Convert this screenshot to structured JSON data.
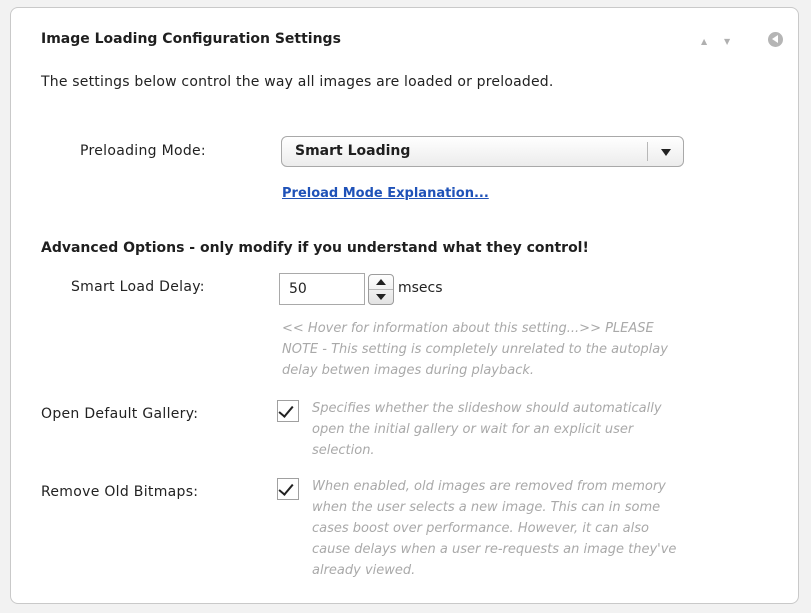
{
  "panel": {
    "title": "Image Loading Configuration Settings",
    "controls": {
      "move_up_icon": "triangle-up",
      "move_down_icon": "triangle-down",
      "collapse_icon": "circle-left-arrow"
    },
    "intro": "The settings below control the way all images are loaded or preloaded."
  },
  "preloading": {
    "label": "Preloading Mode:",
    "selected": "Smart Loading",
    "explanation_link": "Preload Mode Explanation..."
  },
  "advanced": {
    "heading": "Advanced Options - only modify if you understand what they control!",
    "smart_load_delay": {
      "label": "Smart Load Delay:",
      "value": "50",
      "unit": "msecs",
      "help_lines": [
        "<< Hover for information about this setting...>> PLEASE",
        "NOTE - This setting is completely unrelated to the autoplay",
        "delay betwen images during playback."
      ]
    },
    "open_default_gallery": {
      "label": "Open Default Gallery:",
      "checked": true,
      "help_lines": [
        "Specifies whether the slideshow should automatically",
        "open the initial gallery or wait for an explicit user",
        "selection."
      ]
    },
    "remove_old_bitmaps": {
      "label": "Remove Old Bitmaps:",
      "checked": true,
      "help_lines": [
        "When enabled, old images are removed from memory",
        "when the user selects a new image.  This can in some",
        "cases boost over performance.  However, it can also",
        "cause delays when a user re-requests an image they've",
        "already viewed."
      ]
    }
  },
  "colors": {
    "link": "#1f52b8",
    "help_text": "#a9a9a9",
    "background": "#f2f2f2"
  }
}
